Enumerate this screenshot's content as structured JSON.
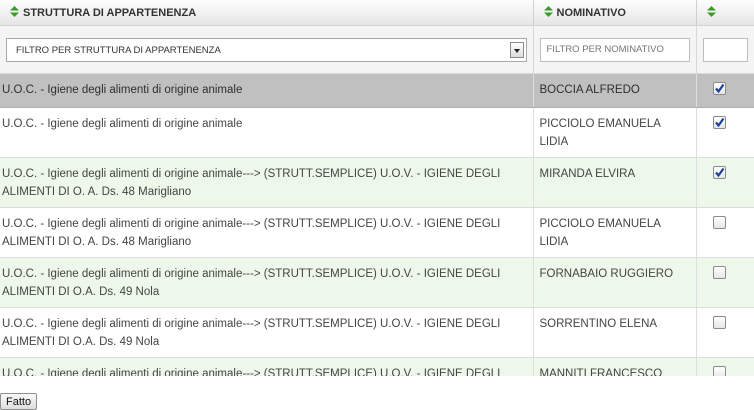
{
  "headers": {
    "struttura": "STRUTTURA DI APPARTENENZA",
    "nominativo": "NOMINATIVO",
    "select": ""
  },
  "filters": {
    "struttura_selected": "FILTRO PER STRUTTURA DI APPARTENENZA",
    "nominativo_placeholder": "FILTRO PER NOMINATIVO"
  },
  "rows": [
    {
      "struttura": "U.O.C. - Igiene degli alimenti di origine animale",
      "nominativo": "BOCCIA ALFREDO",
      "checked": true
    },
    {
      "struttura": "U.O.C. - Igiene degli alimenti di origine animale",
      "nominativo": "PICCIOLO EMANUELA LIDIA",
      "checked": true
    },
    {
      "struttura": "U.O.C. - Igiene degli alimenti di origine animale---> (STRUTT.SEMPLICE) U.O.V. - IGIENE DEGLI ALIMENTI DI O. A. Ds. 48 Marigliano",
      "nominativo": "MIRANDA ELVIRA",
      "checked": true
    },
    {
      "struttura": "U.O.C. - Igiene degli alimenti di origine animale---> (STRUTT.SEMPLICE) U.O.V. - IGIENE DEGLI ALIMENTI DI O. A. Ds. 48 Marigliano",
      "nominativo": "PICCIOLO EMANUELA LIDIA",
      "checked": false
    },
    {
      "struttura": "U.O.C. - Igiene degli alimenti di origine animale---> (STRUTT.SEMPLICE) U.O.V. - IGIENE DEGLI ALIMENTI DI O.A. Ds. 49 Nola",
      "nominativo": "FORNABAIO RUGGIERO",
      "checked": false
    },
    {
      "struttura": "U.O.C. - Igiene degli alimenti di origine animale---> (STRUTT.SEMPLICE) U.O.V. - IGIENE DEGLI ALIMENTI DI O.A. Ds. 49 Nola",
      "nominativo": "SORRENTINO ELENA",
      "checked": false
    },
    {
      "struttura": "U.O.C. - Igiene degli alimenti di origine animale---> (STRUTT.SEMPLICE) U.O.V. - IGIENE DEGLI",
      "nominativo": "MANNITI FRANCESCO",
      "checked": false
    }
  ],
  "footer": {
    "done_label": "Fatto"
  },
  "colors": {
    "sort_icon": "#3a9a2a",
    "selected_row": "#c0c0c0",
    "alt_row": "#eef8ea",
    "check": "#1c3f9e"
  }
}
